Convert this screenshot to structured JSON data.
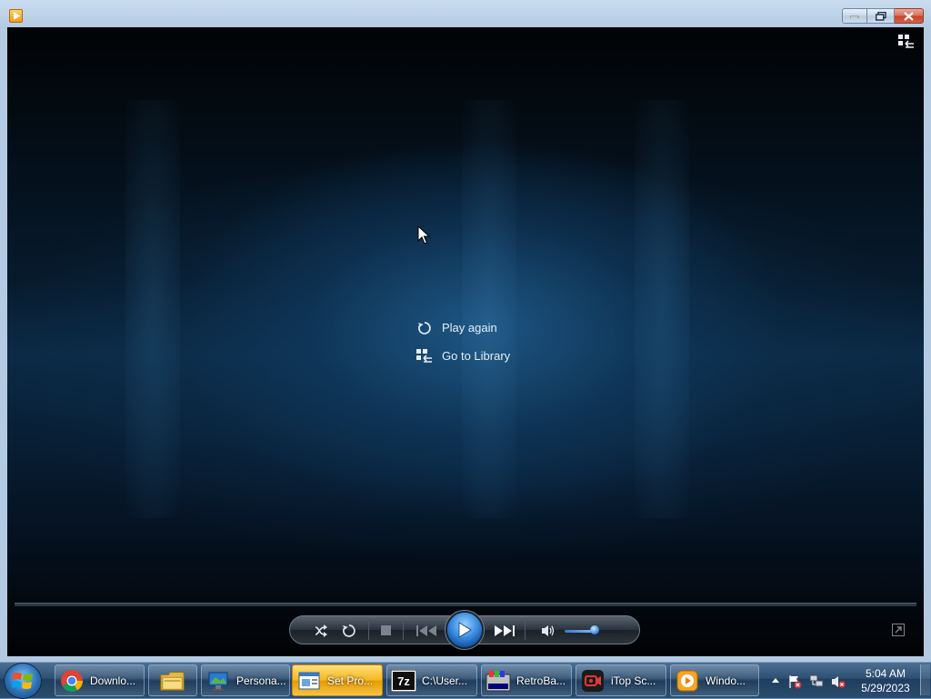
{
  "window": {
    "app_icon": "media-player-icon",
    "buttons": {
      "minimize": "minimize-icon",
      "maximize": "maximize-icon",
      "close": "close-icon"
    }
  },
  "player": {
    "top_right_icon": "switch-to-library-icon",
    "menu": {
      "play_again": {
        "label": "Play again",
        "icon": "replay-icon"
      },
      "go_to_library": {
        "label": "Go to Library",
        "icon": "library-icon"
      }
    },
    "controls": {
      "shuffle": "shuffle-icon",
      "repeat": "repeat-icon",
      "stop": "stop-icon",
      "previous": "previous-icon",
      "play": "play-icon",
      "next": "next-icon",
      "mute": "speaker-icon",
      "volume_level": 0.52,
      "fullscreen": "fullscreen-icon"
    },
    "accent": "#3c8ee0"
  },
  "taskbar": {
    "items": [
      {
        "label": "Downlo...",
        "icon": "chrome-icon",
        "active": false
      },
      {
        "label": "",
        "icon": "folder-icon",
        "active": false
      },
      {
        "label": "Persona...",
        "icon": "personalization-icon",
        "active": false
      },
      {
        "label": "Set Pro...",
        "icon": "set-program-icon",
        "active": true
      },
      {
        "label": "C:\\User...",
        "icon": "7zip-icon",
        "active": false
      },
      {
        "label": "RetroBa...",
        "icon": "retrobar-icon",
        "active": false
      },
      {
        "label": "iTop Sc...",
        "icon": "itop-screen-recorder-icon",
        "active": false
      },
      {
        "label": "Windo...",
        "icon": "windows-media-player-icon",
        "active": false
      }
    ],
    "clock": {
      "time": "5:04 AM",
      "date": "5/29/2023"
    }
  }
}
